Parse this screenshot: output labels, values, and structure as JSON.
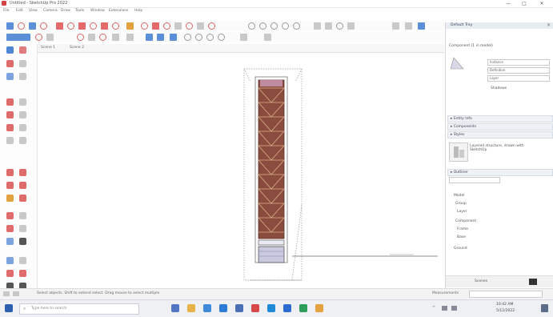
{
  "window": {
    "title": "Untitled - SketchUp Pro 2022",
    "controls": [
      "—",
      "□",
      "✕"
    ]
  },
  "menu": [
    "File",
    "Edit",
    "View",
    "Camera",
    "Draw",
    "Tools",
    "Window",
    "Extensions",
    "Help"
  ],
  "scene_tabs": [
    "Scene 1",
    "Scene 2"
  ],
  "right_panel": {
    "title": "Default Tray",
    "sections": [
      {
        "label": "▸ Entity Info"
      },
      {
        "label": "▸ Components"
      },
      {
        "label": "▸ Styles"
      },
      {
        "label": "▸ Outliner"
      }
    ],
    "component_title": "Component (1 in model)",
    "component_desc": "Layered structure, drawn with SketchUp",
    "fields": [
      "Instance",
      "Definition",
      "Layer",
      "Shadows"
    ],
    "outliner_items": [
      "Model",
      "Group",
      "Layer",
      "Component",
      "Frame",
      "Base",
      "Ground"
    ],
    "footer_label": "Scenes"
  },
  "status": {
    "hint": "Select objects. Shift to extend select. Drag mouse to select multiple.",
    "measurements_label": "Measurements"
  },
  "taskbar": {
    "search_placeholder": "Type here to search",
    "time": "10:42 AM",
    "date": "5/12/2022"
  }
}
